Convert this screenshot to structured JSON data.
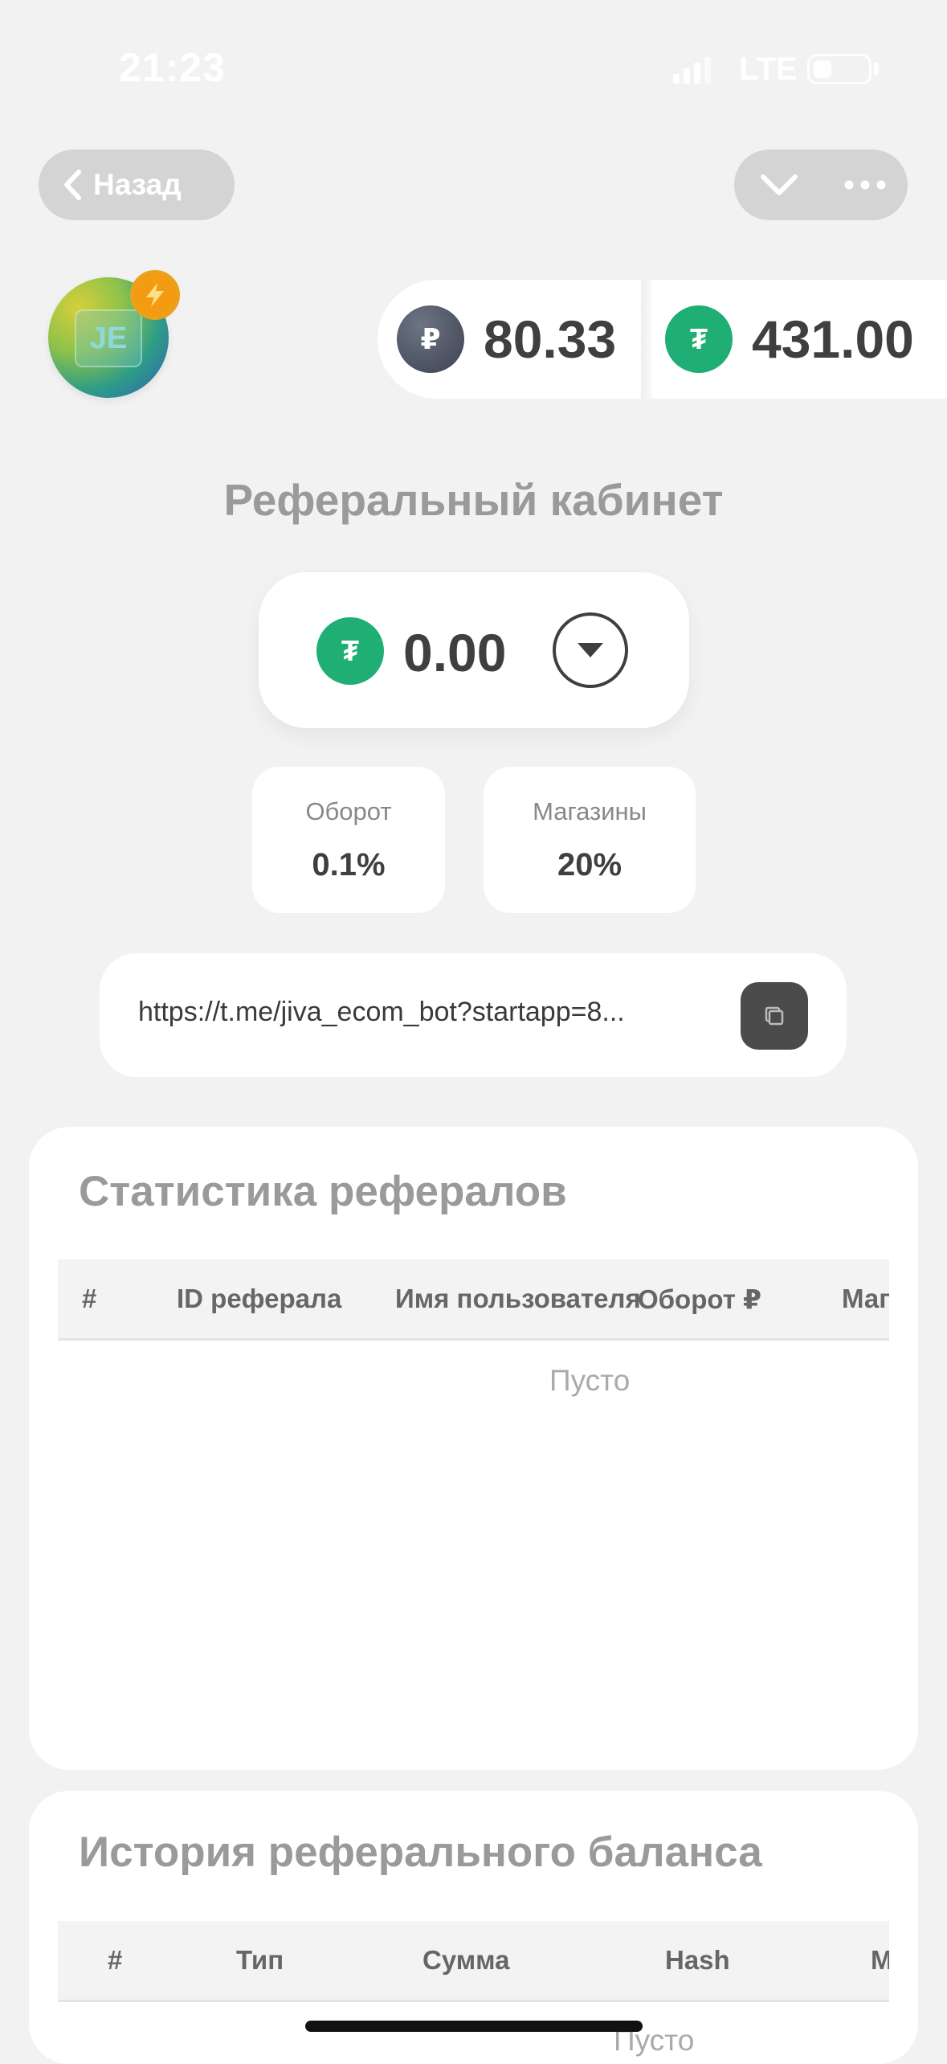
{
  "status_bar": {
    "time": "21:23",
    "network": "LTE"
  },
  "nav": {
    "back_label": "Назад"
  },
  "avatar": {
    "initials": "JE"
  },
  "balances": [
    {
      "currency_symbol": "₽",
      "value": "80.33"
    },
    {
      "currency_symbol": "₮",
      "value": "431.00"
    }
  ],
  "page_title": "Реферальный кабинет",
  "referral_balance": {
    "currency_symbol": "₮",
    "value": "0.00"
  },
  "stats": [
    {
      "label": "Оборот",
      "value": "0.1%"
    },
    {
      "label": "Магазины",
      "value": "20%"
    }
  ],
  "referral_link": "https://t.me/jiva_ecom_bot?startapp=8...",
  "referrals_table": {
    "title": "Статистика рефералов",
    "columns": [
      "#",
      "ID реферала",
      "Имя пользователя",
      "Оборот ₽",
      "Маг"
    ],
    "empty_text": "Пусто"
  },
  "history_table": {
    "title": "История реферального баланса",
    "columns": [
      "#",
      "Тип",
      "Сумма",
      "Hash",
      "М"
    ],
    "empty_text": "Пусто"
  },
  "colors": {
    "usdt": "#1fae73",
    "rub": "#4a5060",
    "badge": "#f39c12"
  },
  "icons": [
    "signal-icon",
    "battery-icon",
    "chevron-left-icon",
    "chevron-down-icon",
    "more-dots-icon",
    "lightning-icon",
    "dropdown-icon",
    "copy-icon"
  ]
}
